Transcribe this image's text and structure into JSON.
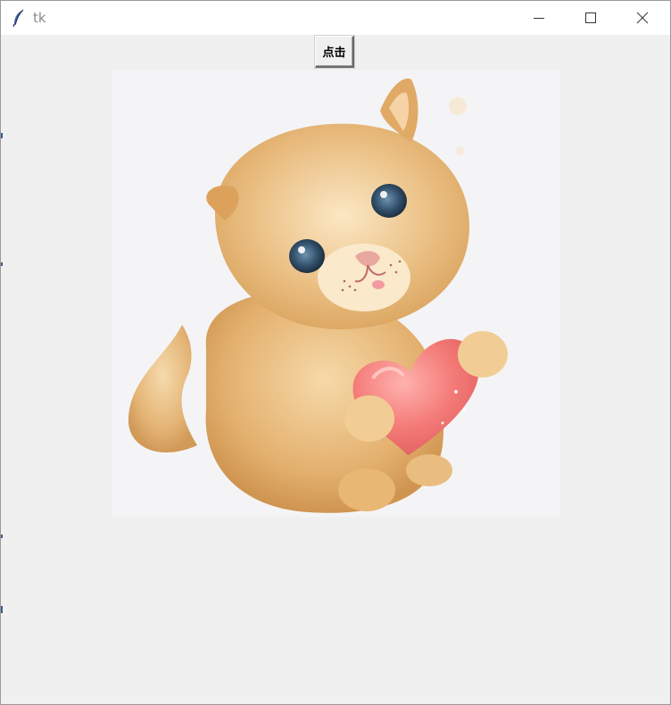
{
  "window": {
    "title": "tk",
    "controls": {
      "minimize_icon": "minimize-icon",
      "maximize_icon": "maximize-icon",
      "close_icon": "close-icon"
    }
  },
  "main": {
    "button_label": "点击",
    "image": {
      "subject": "kitten-holding-heart-illustration"
    }
  },
  "colors": {
    "client_bg": "#f0f0f0",
    "titlebar_bg": "#ffffff",
    "title_text": "#8a8a8a",
    "image_bg": "#f4f4f6",
    "kitten_fur": "#e8b774",
    "heart": "#f07a78",
    "eyes": "#34536e"
  }
}
